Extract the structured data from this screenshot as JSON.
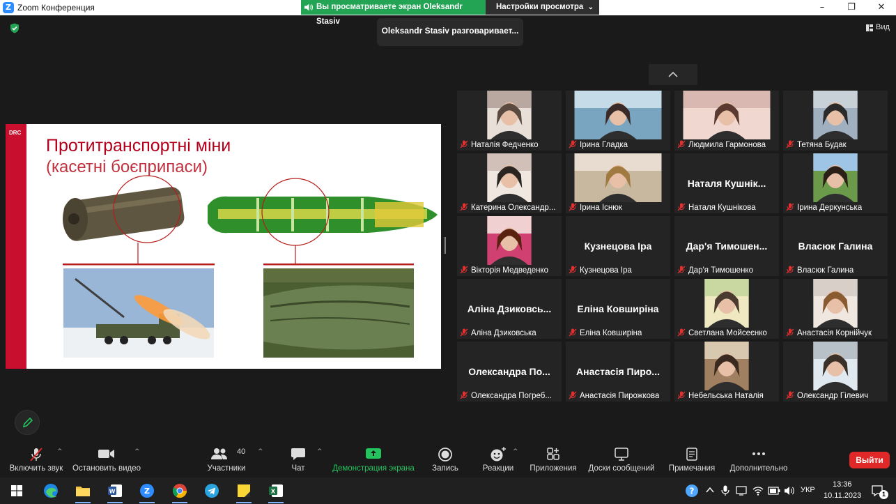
{
  "window": {
    "title": "Zoom Конференция",
    "share_banner": "Вы просматриваете экран Oleksandr Stasiv",
    "view_options": "Настройки просмотра"
  },
  "meeting": {
    "talking": "Oleksandr Stasiv разговаривает...",
    "view_label": "Вид"
  },
  "slide": {
    "logo": "DRC",
    "title": "Протитранспортні міни",
    "subtitle": "(касетні боєприпаси)"
  },
  "participants": [
    {
      "name": "Наталія Федченко",
      "video": true
    },
    {
      "name": "Ірина Гладка",
      "video": true
    },
    {
      "name": "Людмила Гармонова",
      "video": true
    },
    {
      "name": "Тетяна Будак",
      "video": true
    },
    {
      "name": "Катерина Олександр...",
      "video": true
    },
    {
      "name": "Ірина Існюк",
      "video": true
    },
    {
      "name": "Наталя Кушнікова",
      "video": false,
      "display": "Наталя Кушнік..."
    },
    {
      "name": "Ірина Деркунська",
      "video": true
    },
    {
      "name": "Вікторія Медведенко",
      "video": true
    },
    {
      "name": "Кузнецова Іра",
      "video": false,
      "display": "Кузнецова Іра"
    },
    {
      "name": "Дар'я Тимошенко",
      "video": false,
      "display": "Дар'я Тимошен..."
    },
    {
      "name": "Власюк Галина",
      "video": false,
      "display": "Власюк Галина"
    },
    {
      "name": "Аліна Дзиковська",
      "video": false,
      "display": "Аліна Дзиковсь..."
    },
    {
      "name": "Еліна Ковширіна",
      "video": false,
      "display": "Еліна Ковширіна"
    },
    {
      "name": "Светлана Мойсеєнко",
      "video": true
    },
    {
      "name": "Анастасія Корнійчук",
      "video": true
    },
    {
      "name": "Олександра Погреб...",
      "video": false,
      "display": "Олександра По..."
    },
    {
      "name": "Анастасія Пирожкова",
      "video": false,
      "display": "Анастасія Пиро..."
    },
    {
      "name": "Небельська Наталія",
      "video": true
    },
    {
      "name": "Олександр Гілевич",
      "video": true
    }
  ],
  "toolbar": {
    "audio": "Включить звук",
    "video": "Остановить видео",
    "participants": "Участники",
    "participants_count": "40",
    "chat": "Чат",
    "share": "Демонстрация экрана",
    "record": "Запись",
    "reactions": "Реакции",
    "apps": "Приложения",
    "whiteboards": "Доски сообщений",
    "notes": "Примечания",
    "more": "Дополнительно",
    "leave": "Выйти"
  },
  "taskbar": {
    "language": "УКР",
    "time": "13:36",
    "date": "10.11.2023",
    "notifications": "1"
  },
  "colors": {
    "share_green": "#23a455",
    "leave_red": "#e02828",
    "slide_red": "#c8102e",
    "zoom_blue": "#2d8cff"
  }
}
